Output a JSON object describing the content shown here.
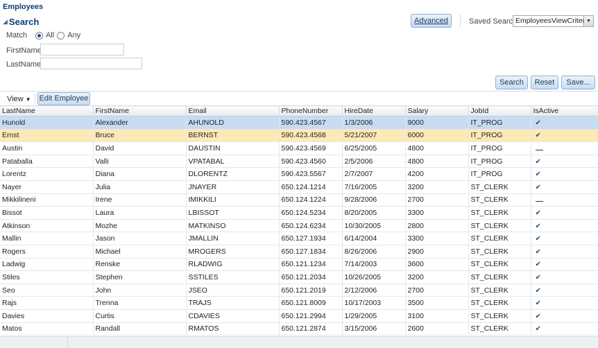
{
  "page_title": "Employees",
  "search": {
    "title": "Search",
    "advanced_label": "Advanced",
    "saved_search_label": "Saved Search",
    "saved_search_value": "EmployeesViewCriteria",
    "match_label": "Match",
    "match_all": "All",
    "match_any": "Any",
    "match_selected": "All",
    "fields": [
      {
        "label": "FirstName",
        "value": ""
      },
      {
        "label": "LastName",
        "value": ""
      }
    ],
    "buttons": {
      "search": "Search",
      "reset": "Reset",
      "save": "Save..."
    }
  },
  "toolbar": {
    "view_label": "View",
    "edit_label": "Edit Employee"
  },
  "table": {
    "columns": [
      "LastName",
      "FirstName",
      "Email",
      "PhoneNumber",
      "HireDate",
      "Salary",
      "JobId",
      "IsActive"
    ],
    "rows": [
      {
        "LastName": "Hunold",
        "FirstName": "Alexander",
        "Email": "AHUNOLD",
        "PhoneNumber": "590.423.4567",
        "HireDate": "1/3/2006",
        "Salary": "9000",
        "JobId": "IT_PROG",
        "IsActive": true,
        "state": "selected"
      },
      {
        "LastName": "Ernst",
        "FirstName": "Bruce",
        "Email": "BERNST",
        "PhoneNumber": "590.423.4568",
        "HireDate": "5/21/2007",
        "Salary": "6000",
        "JobId": "IT_PROG",
        "IsActive": true,
        "state": "highlight"
      },
      {
        "LastName": "Austin",
        "FirstName": "David",
        "Email": "DAUSTIN",
        "PhoneNumber": "590.423.4569",
        "HireDate": "6/25/2005",
        "Salary": "4800",
        "JobId": "IT_PROG",
        "IsActive": false,
        "state": ""
      },
      {
        "LastName": "Pataballa",
        "FirstName": "Valli",
        "Email": "VPATABAL",
        "PhoneNumber": "590.423.4560",
        "HireDate": "2/5/2006",
        "Salary": "4800",
        "JobId": "IT_PROG",
        "IsActive": true,
        "state": ""
      },
      {
        "LastName": "Lorentz",
        "FirstName": "Diana",
        "Email": "DLORENTZ",
        "PhoneNumber": "590.423.5567",
        "HireDate": "2/7/2007",
        "Salary": "4200",
        "JobId": "IT_PROG",
        "IsActive": true,
        "state": ""
      },
      {
        "LastName": "Nayer",
        "FirstName": "Julia",
        "Email": "JNAYER",
        "PhoneNumber": "650.124.1214",
        "HireDate": "7/16/2005",
        "Salary": "3200",
        "JobId": "ST_CLERK",
        "IsActive": true,
        "state": ""
      },
      {
        "LastName": "Mikkilineni",
        "FirstName": "Irene",
        "Email": "IMIKKILI",
        "PhoneNumber": "650.124.1224",
        "HireDate": "9/28/2006",
        "Salary": "2700",
        "JobId": "ST_CLERK",
        "IsActive": false,
        "state": ""
      },
      {
        "LastName": "Bissot",
        "FirstName": "Laura",
        "Email": "LBISSOT",
        "PhoneNumber": "650.124.5234",
        "HireDate": "8/20/2005",
        "Salary": "3300",
        "JobId": "ST_CLERK",
        "IsActive": true,
        "state": ""
      },
      {
        "LastName": "Atkinson",
        "FirstName": "Mozhe",
        "Email": "MATKINSO",
        "PhoneNumber": "650.124.6234",
        "HireDate": "10/30/2005",
        "Salary": "2800",
        "JobId": "ST_CLERK",
        "IsActive": true,
        "state": ""
      },
      {
        "LastName": "Mallin",
        "FirstName": "Jason",
        "Email": "JMALLIN",
        "PhoneNumber": "650.127.1934",
        "HireDate": "6/14/2004",
        "Salary": "3300",
        "JobId": "ST_CLERK",
        "IsActive": true,
        "state": ""
      },
      {
        "LastName": "Rogers",
        "FirstName": "Michael",
        "Email": "MROGERS",
        "PhoneNumber": "650.127.1834",
        "HireDate": "8/26/2006",
        "Salary": "2900",
        "JobId": "ST_CLERK",
        "IsActive": true,
        "state": ""
      },
      {
        "LastName": "Ladwig",
        "FirstName": "Renske",
        "Email": "RLADWIG",
        "PhoneNumber": "650.121.1234",
        "HireDate": "7/14/2003",
        "Salary": "3600",
        "JobId": "ST_CLERK",
        "IsActive": true,
        "state": ""
      },
      {
        "LastName": "Stiles",
        "FirstName": "Stephen",
        "Email": "SSTILES",
        "PhoneNumber": "650.121.2034",
        "HireDate": "10/26/2005",
        "Salary": "3200",
        "JobId": "ST_CLERK",
        "IsActive": true,
        "state": ""
      },
      {
        "LastName": "Seo",
        "FirstName": "John",
        "Email": "JSEO",
        "PhoneNumber": "650.121.2019",
        "HireDate": "2/12/2006",
        "Salary": "2700",
        "JobId": "ST_CLERK",
        "IsActive": true,
        "state": ""
      },
      {
        "LastName": "Rajs",
        "FirstName": "Trenna",
        "Email": "TRAJS",
        "PhoneNumber": "650.121.8009",
        "HireDate": "10/17/2003",
        "Salary": "3500",
        "JobId": "ST_CLERK",
        "IsActive": true,
        "state": ""
      },
      {
        "LastName": "Davies",
        "FirstName": "Curtis",
        "Email": "CDAVIES",
        "PhoneNumber": "650.121.2994",
        "HireDate": "1/29/2005",
        "Salary": "3100",
        "JobId": "ST_CLERK",
        "IsActive": true,
        "state": ""
      },
      {
        "LastName": "Matos",
        "FirstName": "Randall",
        "Email": "RMATOS",
        "PhoneNumber": "650.121.2874",
        "HireDate": "3/15/2006",
        "Salary": "2600",
        "JobId": "ST_CLERK",
        "IsActive": true,
        "state": ""
      }
    ]
  },
  "icons": {
    "search_section": "collapse-triangle-icon",
    "view_menu": "chevron-down-icon",
    "is_active_true": "check-icon",
    "is_active_false": "unchecked-icon",
    "select_arrow": "dropdown-arrow-icon"
  },
  "colors": {
    "title": "#0b3d74",
    "selected_row": "#c7dcf1",
    "highlight_row": "#fde9b5",
    "button_border": "#8fb0d3"
  }
}
